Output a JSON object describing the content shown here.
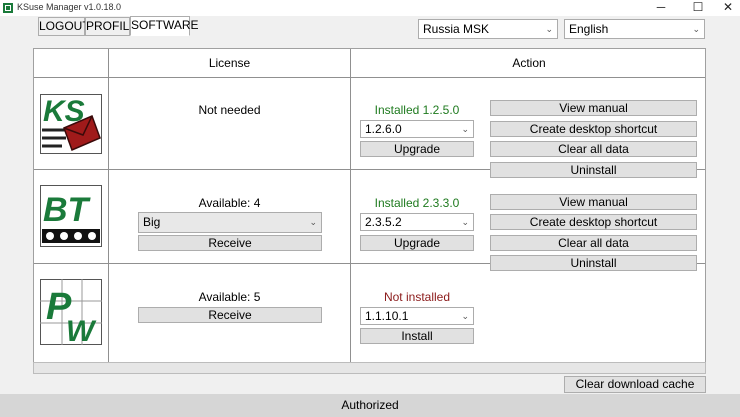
{
  "window": {
    "title": "KSuse Manager v1.0.18.0",
    "minimize_glyph": "─",
    "maximize_glyph": "☐",
    "close_glyph": "✕"
  },
  "tabs": [
    {
      "label": "LOGOUT",
      "active": false
    },
    {
      "label": "PROFILE",
      "active": false
    },
    {
      "label": "SOFTWARE",
      "active": true
    }
  ],
  "region_select": {
    "value": "Russia MSK"
  },
  "language_select": {
    "value": "English"
  },
  "table": {
    "headers": {
      "license": "License",
      "action": "Action"
    },
    "rows": [
      {
        "product": "KS",
        "license_text": "Not needed",
        "status": "Installed 1.2.5.0",
        "status_color": "green",
        "version_select": "1.2.6.0",
        "main_button": "Upgrade",
        "actions": [
          "View manual",
          "Create desktop shortcut",
          "Clear all data",
          "Uninstall"
        ]
      },
      {
        "product": "BT",
        "license_text": "Available: 4",
        "license_select": "Big",
        "license_button": "Receive",
        "status": "Installed 2.3.3.0",
        "status_color": "green",
        "version_select": "2.3.5.2",
        "main_button": "Upgrade",
        "actions": [
          "View manual",
          "Create desktop shortcut",
          "Clear all data",
          "Uninstall"
        ]
      },
      {
        "product": "PW",
        "license_text": "Available: 5",
        "license_button": "Receive",
        "status": "Not installed",
        "status_color": "red",
        "version_select": "1.1.10.1",
        "main_button": "Install"
      }
    ]
  },
  "clear_cache_button": "Clear download cache",
  "statusbar": {
    "text": "Authorized"
  },
  "colors": {
    "installed": "#1e7a1e",
    "not_installed": "#8b1a1a",
    "logo_green": "#1a7a3a"
  }
}
